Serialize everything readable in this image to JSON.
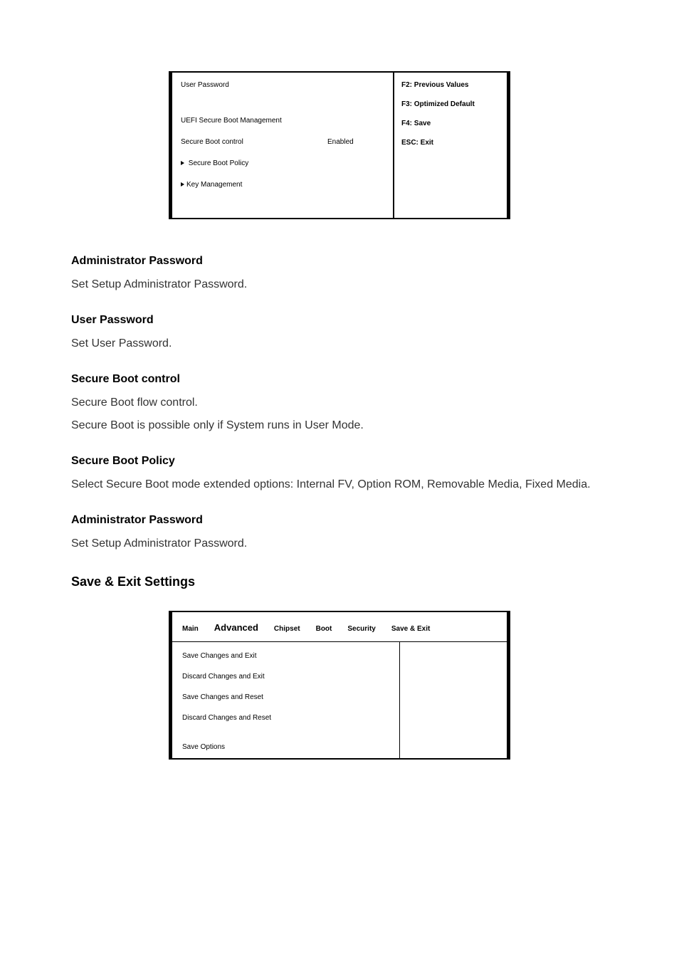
{
  "bios1": {
    "left": {
      "user_password": "User Password",
      "uefi_mgmt": "UEFI Secure Boot Management",
      "secure_boot_control_label": "Secure Boot control",
      "secure_boot_control_value": "Enabled",
      "secure_boot_policy": "Secure Boot Policy",
      "key_mgmt": "Key Management"
    },
    "right": {
      "f2": "F2:   Previous Values",
      "f3": "F3: Optimized Default",
      "f4": "F4: Save",
      "esc": "ESC: Exit"
    }
  },
  "sections": {
    "admin_pw": {
      "title": "Administrator Password",
      "body": "Set Setup Administrator Password."
    },
    "user_pw": {
      "title": "User Password",
      "body": "Set User Password."
    },
    "secure_boot_ctrl": {
      "title": "Secure Boot control",
      "body1": "Secure Boot flow control.",
      "body2": "Secure Boot is possible only if System runs in User Mode."
    },
    "secure_boot_policy": {
      "title": "Secure Boot Policy",
      "body": "Select Secure Boot mode extended options: Internal FV, Option ROM, Removable Media, Fixed Media."
    },
    "admin_pw2": {
      "title": "Administrator Password",
      "body": "Set Setup Administrator Password."
    }
  },
  "save_exit_heading": "Save & Exit Settings",
  "bios2": {
    "tabs": {
      "main": "Main",
      "advanced": "Advanced",
      "chipset": "Chipset",
      "boot": "Boot",
      "security": "Security",
      "save_exit": "Save & Exit"
    },
    "items": {
      "i1": "Save Changes and Exit",
      "i2": "Discard Changes and Exit",
      "i3": "Save Changes and Reset",
      "i4": "Discard Changes and Reset",
      "i5": "Save Options"
    }
  }
}
